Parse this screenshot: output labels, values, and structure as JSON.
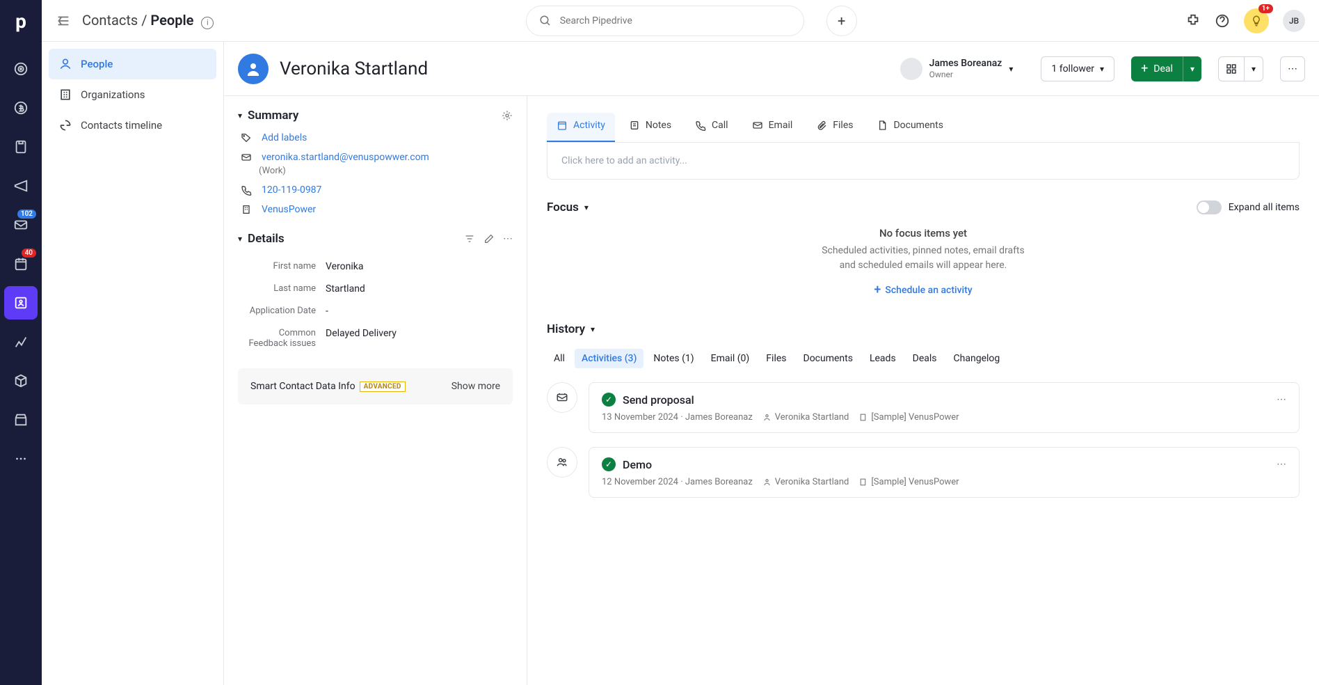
{
  "breadcrumb": {
    "parent": "Contacts",
    "current": "People"
  },
  "search_placeholder": "Search Pipedrive",
  "rail_badges": {
    "inbox": "102",
    "calendar": "40",
    "bulb": "1+"
  },
  "user_initials": "JB",
  "subnav": {
    "people": "People",
    "orgs": "Organizations",
    "timeline": "Contacts timeline"
  },
  "person": {
    "name": "Veronika Startland",
    "owner_name": "James Boreanaz",
    "owner_role": "Owner",
    "followers": "1 follower",
    "deal_btn": "Deal"
  },
  "summary": {
    "title": "Summary",
    "add_labels": "Add labels",
    "email": "veronika.startland@venuspowwer.com",
    "email_type": "(Work)",
    "phone": "120-119-0987",
    "org": "VenusPower"
  },
  "details": {
    "title": "Details",
    "rows": [
      {
        "label": "First name",
        "value": "Veronika"
      },
      {
        "label": "Last name",
        "value": "Startland"
      },
      {
        "label": "Application Date",
        "value": "-"
      },
      {
        "label": "Common Feedback issues",
        "value": "Delayed Delivery"
      }
    ]
  },
  "smart": {
    "label": "Smart Contact Data Info",
    "tag": "ADVANCED",
    "show": "Show more"
  },
  "tabs": {
    "activity": "Activity",
    "notes": "Notes",
    "call": "Call",
    "email": "Email",
    "files": "Files",
    "documents": "Documents"
  },
  "activity_placeholder": "Click here to add an activity...",
  "focus": {
    "title": "Focus",
    "expand": "Expand all items",
    "empty_t1": "No focus items yet",
    "empty_t2a": "Scheduled activities, pinned notes, email drafts",
    "empty_t2b": "and scheduled emails will appear here.",
    "schedule": "Schedule an activity"
  },
  "history": {
    "title": "History",
    "filters": [
      "All",
      "Activities (3)",
      "Notes (1)",
      "Email (0)",
      "Files",
      "Documents",
      "Leads",
      "Deals",
      "Changelog"
    ],
    "items": [
      {
        "title": "Send proposal",
        "date": "13 November 2024",
        "owner": "James Boreanaz",
        "person": "Veronika Startland",
        "org": "[Sample] VenusPower"
      },
      {
        "title": "Demo",
        "date": "12 November 2024",
        "owner": "James Boreanaz",
        "person": "Veronika Startland",
        "org": "[Sample] VenusPower"
      }
    ]
  }
}
